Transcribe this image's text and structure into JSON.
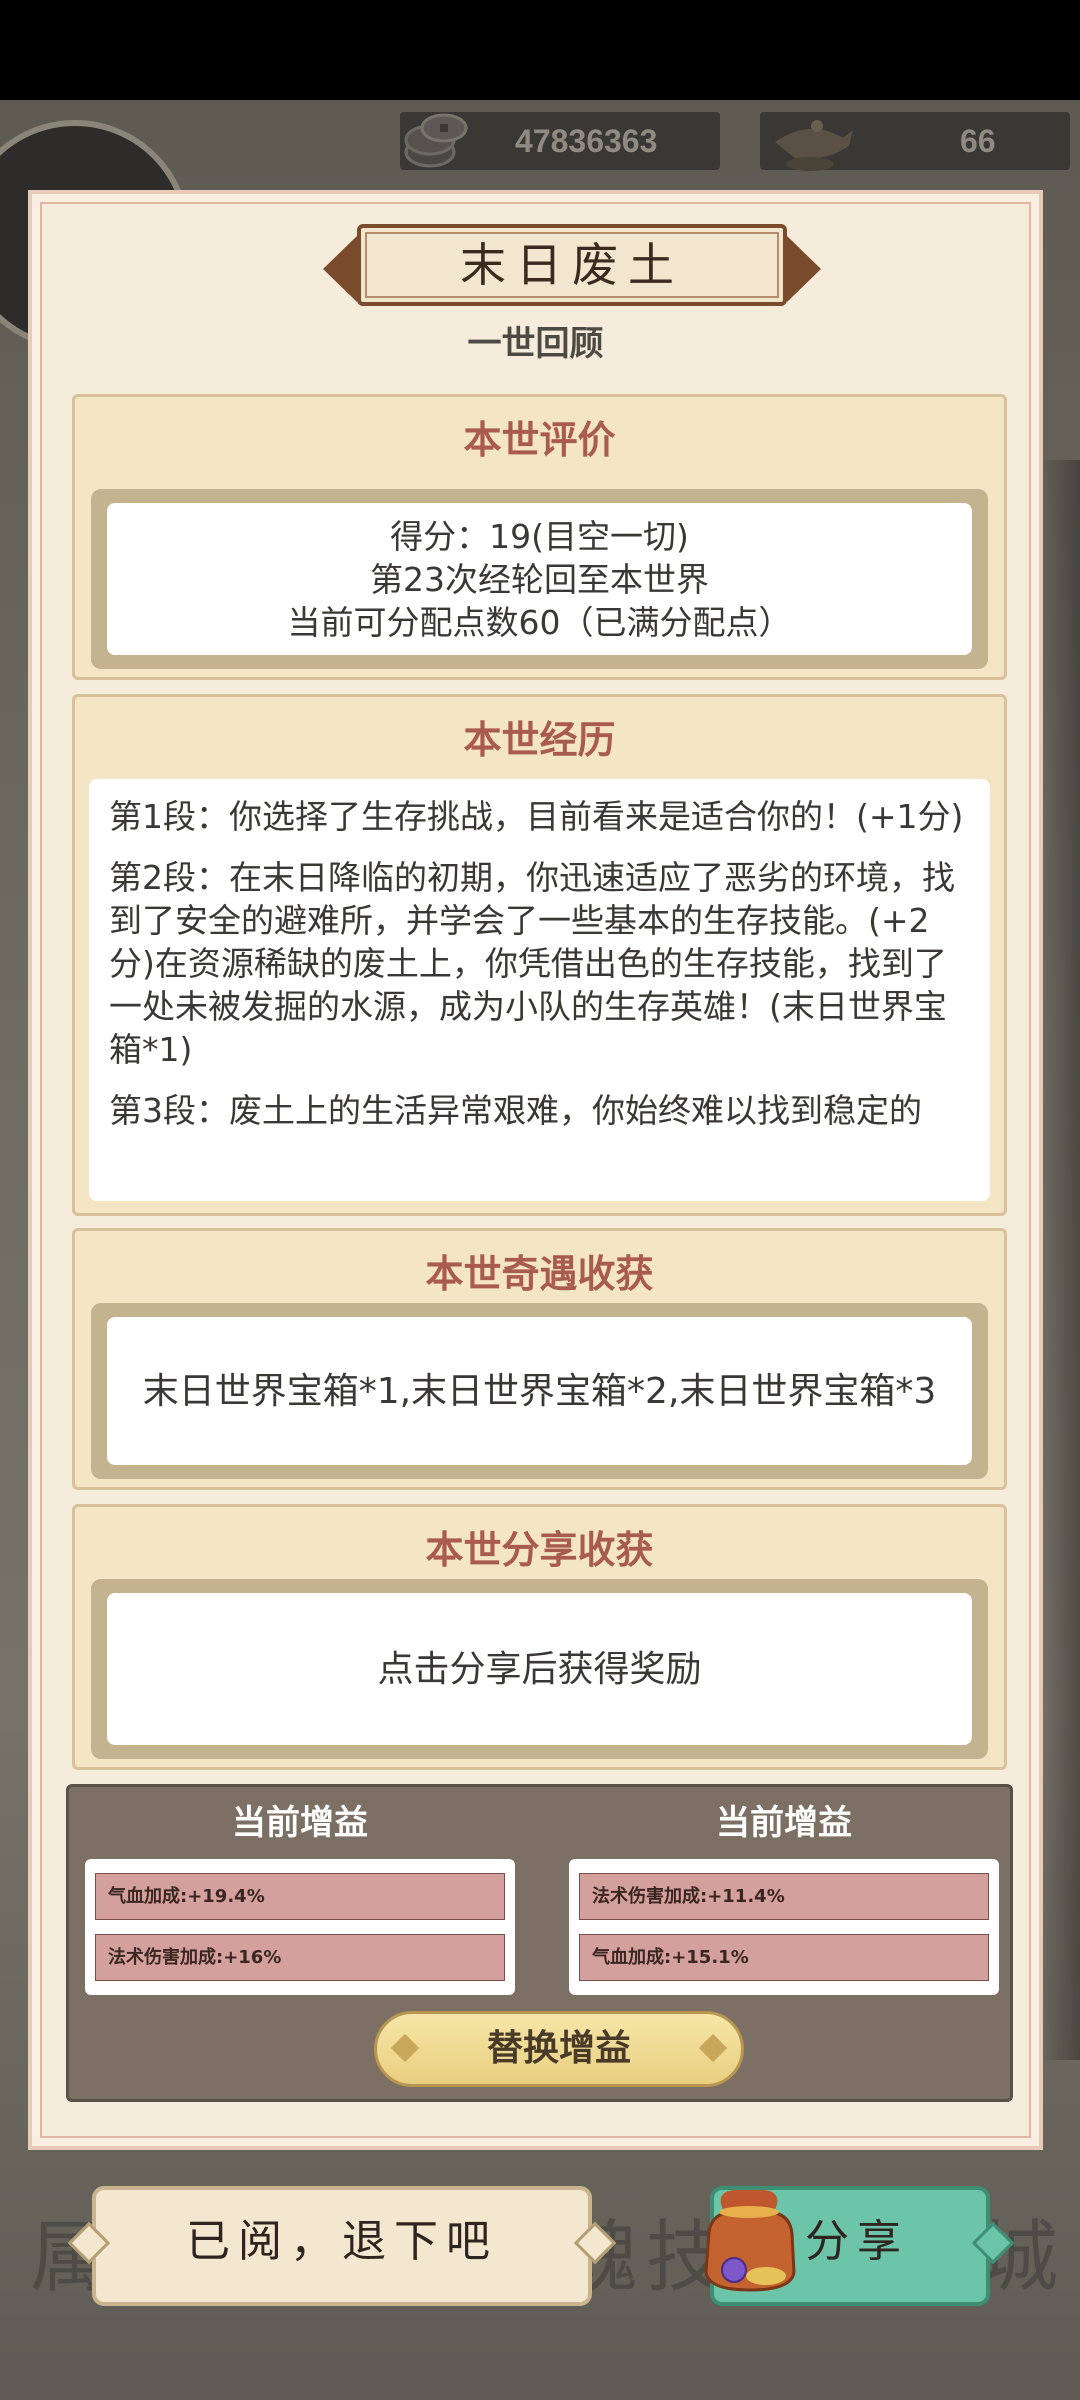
{
  "currency": {
    "coins": "47836363",
    "lamps": "66",
    "coin_icon": "coins-icon",
    "lamp_icon": "lamp-icon"
  },
  "panel": {
    "title": "末日废土",
    "subtitle": "一世回顾"
  },
  "evaluation": {
    "title": "本世评价",
    "lines": [
      "得分：19(目空一切)",
      "第23次经轮回至本世界",
      "当前可分配点数60（已满分配点）"
    ]
  },
  "history": {
    "title": "本世经历",
    "paragraphs": [
      "第1段：你选择了生存挑战，目前看来是适合你的！(+1分)",
      "第2段：在末日降临的初期，你迅速适应了恶劣的环境，找到了安全的避难所，并学会了一些基本的生存技能。(+2分)在资源稀缺的废土上，你凭借出色的生存技能，找到了一处未被发掘的水源，成为小队的生存英雄！(末日世界宝箱*1)",
      "第3段：废土上的生活异常艰难，你始终难以找到稳定的"
    ]
  },
  "encounters": {
    "title": "本世奇遇收获",
    "text": "末日世界宝箱*1,末日世界宝箱*2,末日世界宝箱*3"
  },
  "share_reward": {
    "title": "本世分享收获",
    "text": "点击分享后获得奖励"
  },
  "buffs": {
    "left": {
      "title": "当前增益",
      "items": [
        "气血加成:+19.4%",
        "法术伤害加成:+16%"
      ]
    },
    "right": {
      "title": "当前增益",
      "items": [
        "法术伤害加成:+11.4%",
        "气血加成:+15.1%"
      ]
    },
    "replace_label": "替换增益"
  },
  "buttons": {
    "read_label": "已阅，退下吧",
    "share_label": "分享",
    "share_icon": "treasure-bag-icon"
  },
  "background": {
    "ghost_left": "属",
    "ghost_mid": "魂技",
    "ghost_right": "城"
  },
  "colors": {
    "section_title": "#a85b4e",
    "buff_row": "#d4a09d",
    "share_button": "#6cc5a8",
    "replace_button": "#efd98f"
  }
}
